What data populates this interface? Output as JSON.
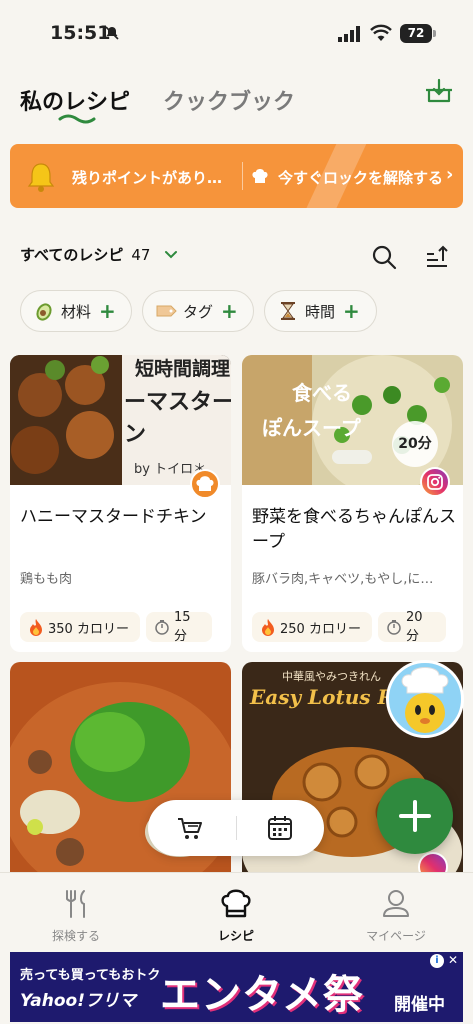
{
  "status_bar": {
    "time": "15:51",
    "battery": "72"
  },
  "header": {
    "tabs": [
      {
        "label": "私のレシピ",
        "active": true
      },
      {
        "label": "クックブック",
        "active": false
      }
    ],
    "download_icon": "download-box-icon"
  },
  "banner": {
    "left_text": "残りポイントがあり…",
    "right_text": "今すぐロックを解除する",
    "color": "#f6943b"
  },
  "recipes_row": {
    "label": "すべてのレシピ",
    "count": "47"
  },
  "filters": [
    {
      "icon": "avocado-icon",
      "label": "材料"
    },
    {
      "icon": "tag-icon",
      "label": "タグ"
    },
    {
      "icon": "hourglass-icon",
      "label": "時間"
    }
  ],
  "cards": [
    {
      "title": "ハニーマスタードチキン",
      "ingredients": "鶏もも肉",
      "calories": "350 カロリー",
      "time": "15 分",
      "image_caption_lines": [
        "短時間調理",
        "ーマスター",
        "ン"
      ],
      "image_credit": "by トイロ＊",
      "source_badge": "chef-hat-badge"
    },
    {
      "title": "野菜を食べるちゃんぽんスープ",
      "ingredients": "豚バラ肉,キャベツ,もやし,に…",
      "calories": "250 カロリー",
      "time": "20 分",
      "image_caption_lines": [
        "食べる",
        "ぽんスープ"
      ],
      "time_badge": "20分",
      "source_badge": "instagram-badge"
    },
    {
      "title": "",
      "image_caption_lines": []
    },
    {
      "title": "",
      "image_caption_lines": [
        "中華風やみつきれん",
        "Easy Lotus Root"
      ],
      "source_badge": "instagram-badge"
    }
  ],
  "bottom_nav": [
    {
      "label": "探検する",
      "icon": "fork-knife-icon",
      "active": false
    },
    {
      "label": "レシピ",
      "icon": "chef-hat-icon",
      "active": true
    },
    {
      "label": "マイページ",
      "icon": "person-icon",
      "active": false
    }
  ],
  "ad": {
    "line1": "売っても買ってもおトク",
    "line2": "Yahoo!フリマ",
    "headline": "エンタメ祭",
    "tag": "開催中"
  },
  "colors": {
    "accent": "#2f8a3e",
    "banner": "#f6943b"
  }
}
